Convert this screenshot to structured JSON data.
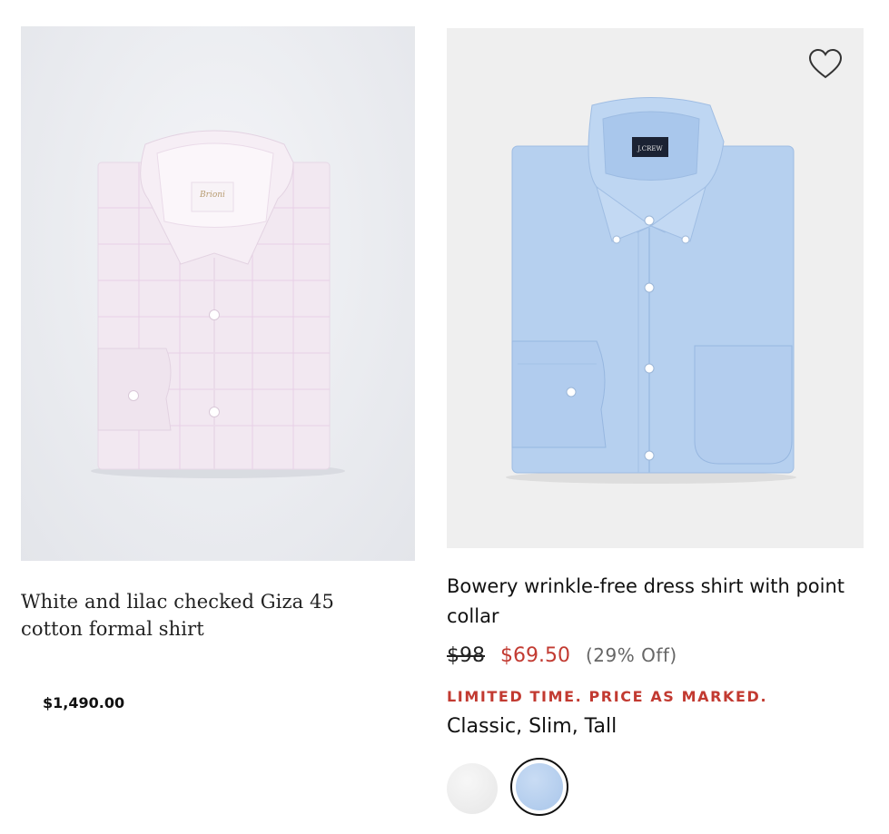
{
  "products": [
    {
      "title": "White and lilac checked Giza 45 cotton formal shirt",
      "price": "$1,490.00",
      "image_icon": "pink-dress-shirt-image",
      "label_text": "Brioni"
    },
    {
      "title": "Bowery wrinkle-free dress shirt with point collar",
      "original_price": "$98",
      "sale_price": "$69.50",
      "discount": "(29% Off)",
      "promo": "LIMITED TIME. PRICE AS MARKED.",
      "fits": "Classic, Slim, Tall",
      "image_icon": "blue-dress-shirt-image",
      "label_text": "J.CREW",
      "favorite_icon": "heart-icon",
      "swatches": [
        {
          "name": "white",
          "color": "#ececec",
          "selected": false
        },
        {
          "name": "light-blue",
          "color": "#b8d0ee",
          "selected": true
        }
      ]
    }
  ],
  "colors": {
    "sale_red": "#c23a31",
    "text_dark": "#111111",
    "text_muted": "#666666"
  }
}
